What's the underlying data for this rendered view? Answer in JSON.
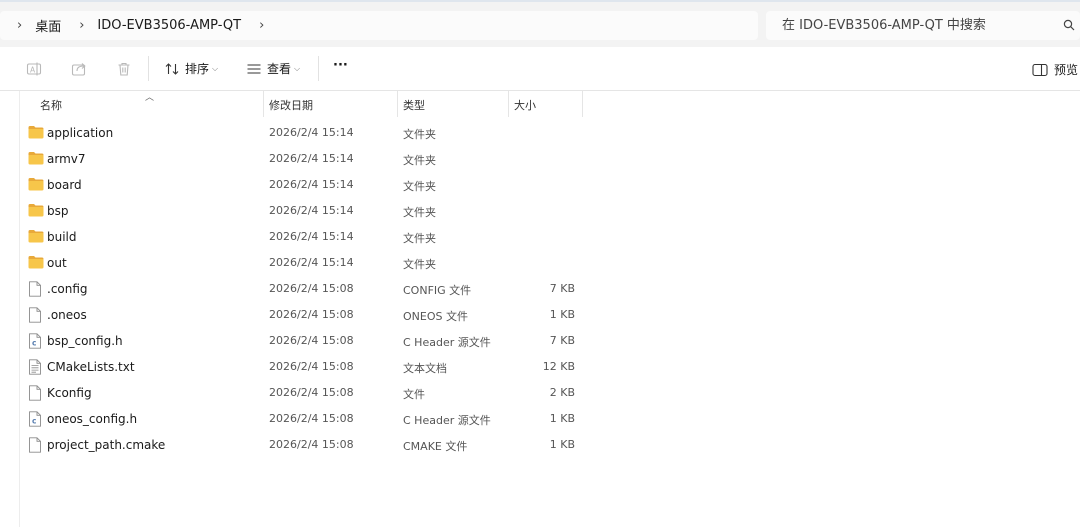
{
  "address_bar": {
    "breadcrumb": [
      "桌面",
      "IDO-EVB3506-AMP-QT"
    ],
    "separator": "›"
  },
  "search": {
    "placeholder": "在 IDO-EVB3506-AMP-QT 中搜索",
    "icon": "search-icon"
  },
  "toolbar": {
    "rename_icon": "rename-icon",
    "share_icon": "share-icon",
    "delete_icon": "trash-icon",
    "sort_label": "排序",
    "view_label": "查看",
    "more_label": "···",
    "preview_label": "预览"
  },
  "columns": {
    "name": "名称",
    "modified": "修改日期",
    "type": "类型",
    "size": "大小"
  },
  "files": [
    {
      "name": "application",
      "date": "2026/2/4 15:14",
      "type": "文件夹",
      "size": "",
      "icon": "folder-icon"
    },
    {
      "name": "armv7",
      "date": "2026/2/4 15:14",
      "type": "文件夹",
      "size": "",
      "icon": "folder-icon"
    },
    {
      "name": "board",
      "date": "2026/2/4 15:14",
      "type": "文件夹",
      "size": "",
      "icon": "folder-icon"
    },
    {
      "name": "bsp",
      "date": "2026/2/4 15:14",
      "type": "文件夹",
      "size": "",
      "icon": "folder-icon"
    },
    {
      "name": "build",
      "date": "2026/2/4 15:14",
      "type": "文件夹",
      "size": "",
      "icon": "folder-icon"
    },
    {
      "name": "out",
      "date": "2026/2/4 15:14",
      "type": "文件夹",
      "size": "",
      "icon": "folder-icon"
    },
    {
      "name": ".config",
      "date": "2026/2/4 15:08",
      "type": "CONFIG 文件",
      "size": "7 KB",
      "icon": "file-icon"
    },
    {
      "name": ".oneos",
      "date": "2026/2/4 15:08",
      "type": "ONEOS 文件",
      "size": "1 KB",
      "icon": "file-icon"
    },
    {
      "name": "bsp_config.h",
      "date": "2026/2/4 15:08",
      "type": "C Header 源文件",
      "size": "7 KB",
      "icon": "c-header-icon"
    },
    {
      "name": "CMakeLists.txt",
      "date": "2026/2/4 15:08",
      "type": "文本文档",
      "size": "12 KB",
      "icon": "text-file-icon"
    },
    {
      "name": "Kconfig",
      "date": "2026/2/4 15:08",
      "type": "文件",
      "size": "2 KB",
      "icon": "file-icon"
    },
    {
      "name": "oneos_config.h",
      "date": "2026/2/4 15:08",
      "type": "C Header 源文件",
      "size": "1 KB",
      "icon": "c-header-icon"
    },
    {
      "name": "project_path.cmake",
      "date": "2026/2/4 15:08",
      "type": "CMAKE 文件",
      "size": "1 KB",
      "icon": "file-icon"
    }
  ],
  "colors": {
    "folder": "#f7c64a",
    "folder_tab": "#e8a93a",
    "c_header_accent": "#5a7fb0"
  }
}
